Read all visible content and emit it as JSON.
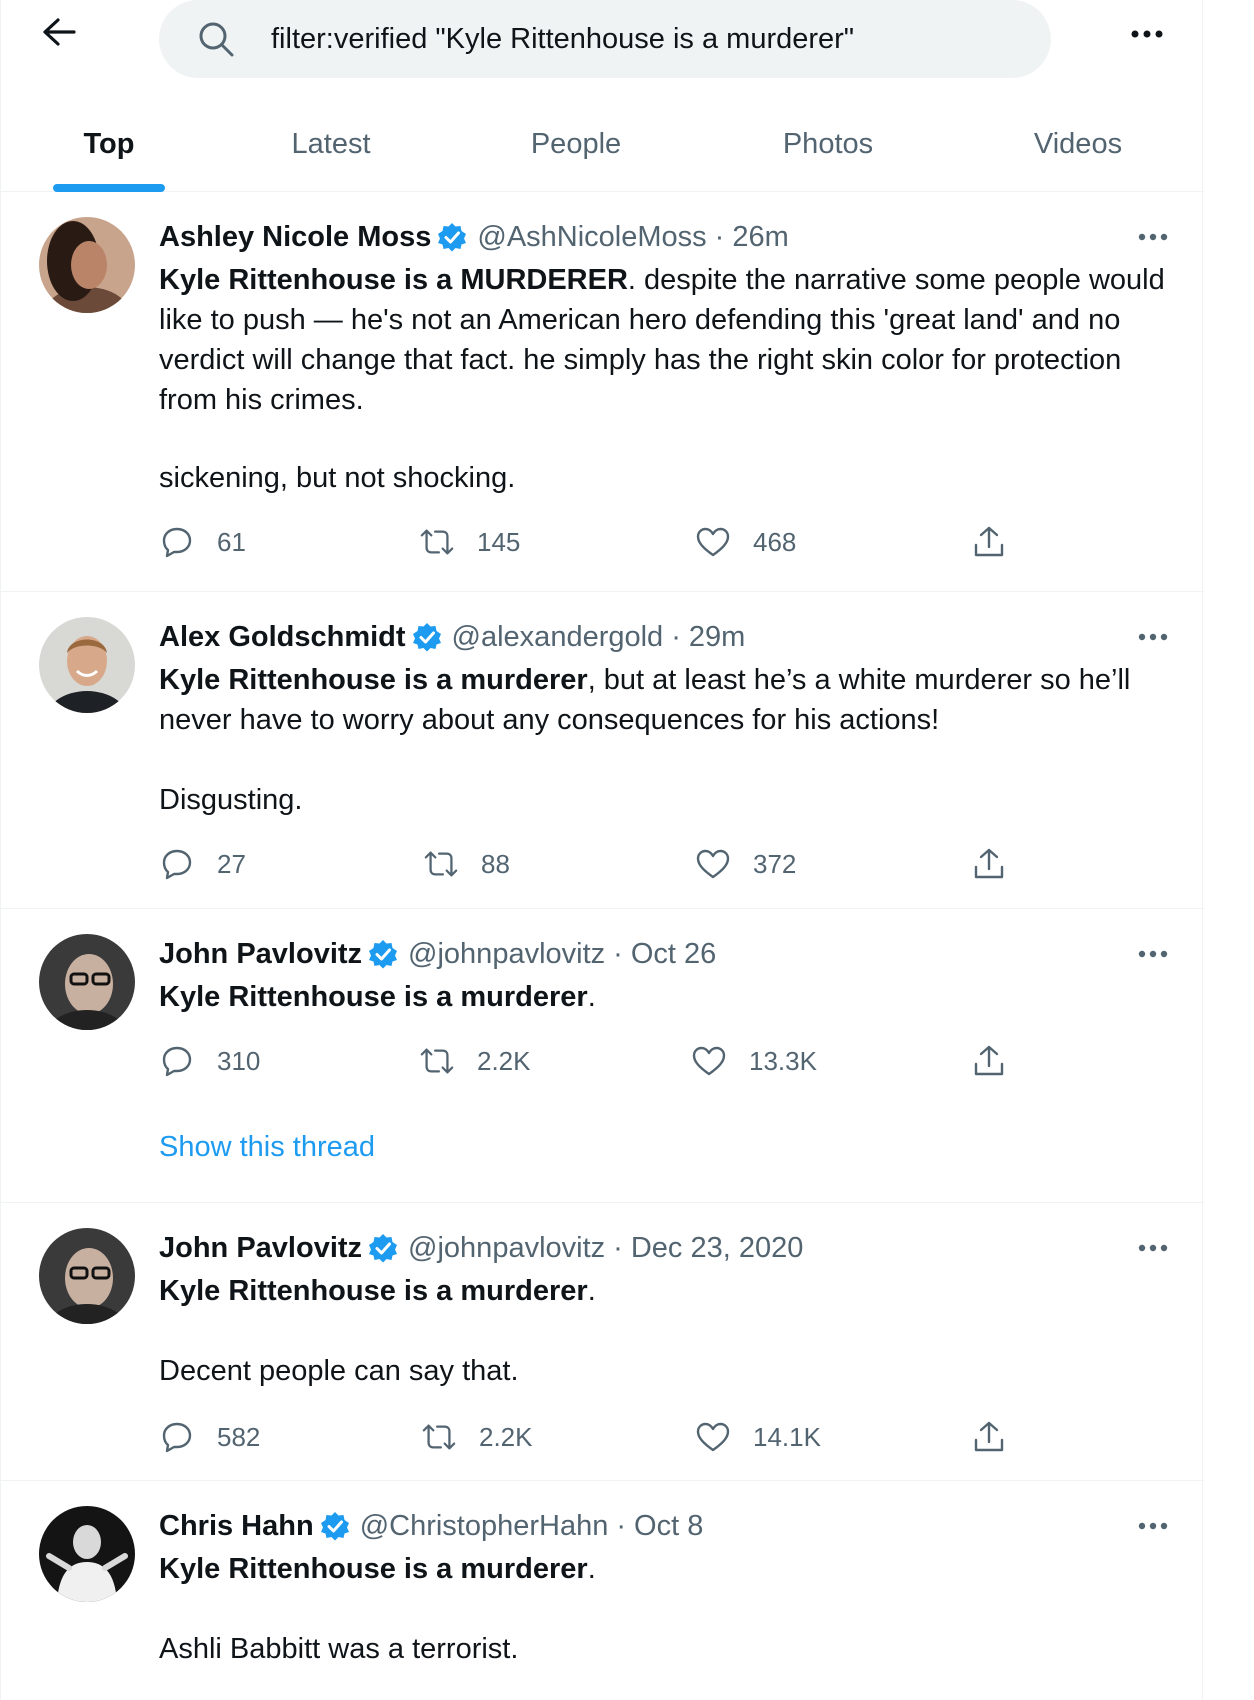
{
  "search": {
    "query": "filter:verified \"Kyle Rittenhouse is a murderer\""
  },
  "tabs": [
    {
      "label": "Top",
      "active": true
    },
    {
      "label": "Latest",
      "active": false
    },
    {
      "label": "People",
      "active": false
    },
    {
      "label": "Photos",
      "active": false
    },
    {
      "label": "Videos",
      "active": false
    }
  ],
  "colors": {
    "accent": "#1d9bf0",
    "text": "#0f1419",
    "muted": "#536471",
    "search_bg": "#eff3f4"
  },
  "icons": {
    "back": "arrow-left-icon",
    "search": "search-icon",
    "more": "more-horizontal-icon",
    "verified": "verified-badge-icon",
    "reply": "reply-icon",
    "retweet": "retweet-icon",
    "like": "heart-icon",
    "share": "share-icon"
  },
  "tweets": [
    {
      "name": "Ashley Nicole Moss",
      "handle": "@AshNicoleMoss",
      "separator": "·",
      "time": "26m",
      "text_bold": "Kyle Rittenhouse is a MURDERER",
      "text_rest": ". despite the narrative some people would like to push — he's not an American hero defending this 'great land' and no verdict will change that fact. he simply has the right skin color for protection from his crimes.",
      "text_extra": "sickening, but not shocking.",
      "replies": "61",
      "retweets": "145",
      "likes": "468"
    },
    {
      "name": "Alex Goldschmidt",
      "handle": "@alexandergold",
      "separator": "·",
      "time": "29m",
      "text_bold": "Kyle Rittenhouse is a murderer",
      "text_rest": ", but at least he’s a white murderer so he’ll never have to worry about any consequences for his actions!",
      "text_extra": "Disgusting.",
      "replies": "27",
      "retweets": "88",
      "likes": "372"
    },
    {
      "name": "John Pavlovitz",
      "handle": "@johnpavlovitz",
      "separator": "·",
      "time": "Oct 26",
      "text_bold": "Kyle Rittenhouse is a murderer",
      "text_rest": ".",
      "replies": "310",
      "retweets": "2.2K",
      "likes": "13.3K",
      "show_thread": "Show this thread"
    },
    {
      "name": "John Pavlovitz",
      "handle": "@johnpavlovitz",
      "separator": "·",
      "time": "Dec 23, 2020",
      "text_bold": "Kyle Rittenhouse is a murderer",
      "text_rest": ".",
      "text_extra": "Decent people can say that.",
      "replies": "582",
      "retweets": "2.2K",
      "likes": "14.1K"
    },
    {
      "name": "Chris Hahn",
      "handle": "@ChristopherHahn",
      "separator": "·",
      "time": "Oct 8",
      "text_bold": "Kyle Rittenhouse is a murderer",
      "text_rest": ".",
      "text_extra": "Ashli Babbitt was a terrorist."
    }
  ]
}
